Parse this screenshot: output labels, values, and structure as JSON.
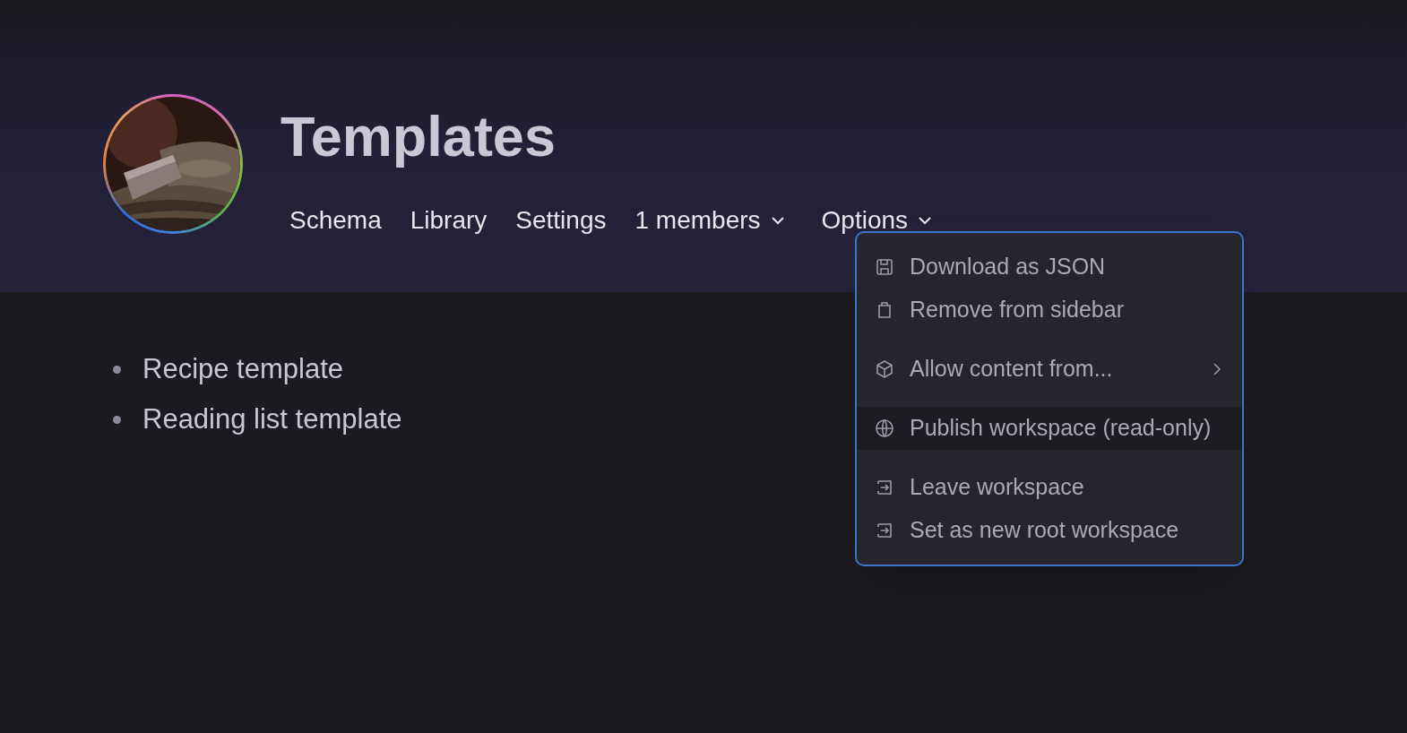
{
  "header": {
    "title": "Templates",
    "nav": [
      {
        "label": "Schema",
        "dropdown": false
      },
      {
        "label": "Library",
        "dropdown": false
      },
      {
        "label": "Settings",
        "dropdown": false
      },
      {
        "label": "1 members",
        "dropdown": true
      },
      {
        "label": "Options",
        "dropdown": true
      }
    ]
  },
  "items": [
    "Recipe template",
    "Reading list template"
  ],
  "options_menu": {
    "groups": [
      {
        "items": [
          {
            "label": "Download as JSON",
            "selected": false,
            "submenu": false
          },
          {
            "label": "Remove from sidebar",
            "selected": false,
            "submenu": false
          }
        ]
      },
      {
        "items": [
          {
            "label": "Allow content from...",
            "selected": false,
            "submenu": true
          }
        ]
      },
      {
        "items": [
          {
            "label": "Publish workspace (read-only)",
            "selected": true,
            "submenu": false
          }
        ]
      },
      {
        "items": [
          {
            "label": "Leave workspace",
            "selected": false,
            "submenu": false
          },
          {
            "label": "Set as new root workspace",
            "selected": false,
            "submenu": false
          }
        ]
      }
    ]
  }
}
